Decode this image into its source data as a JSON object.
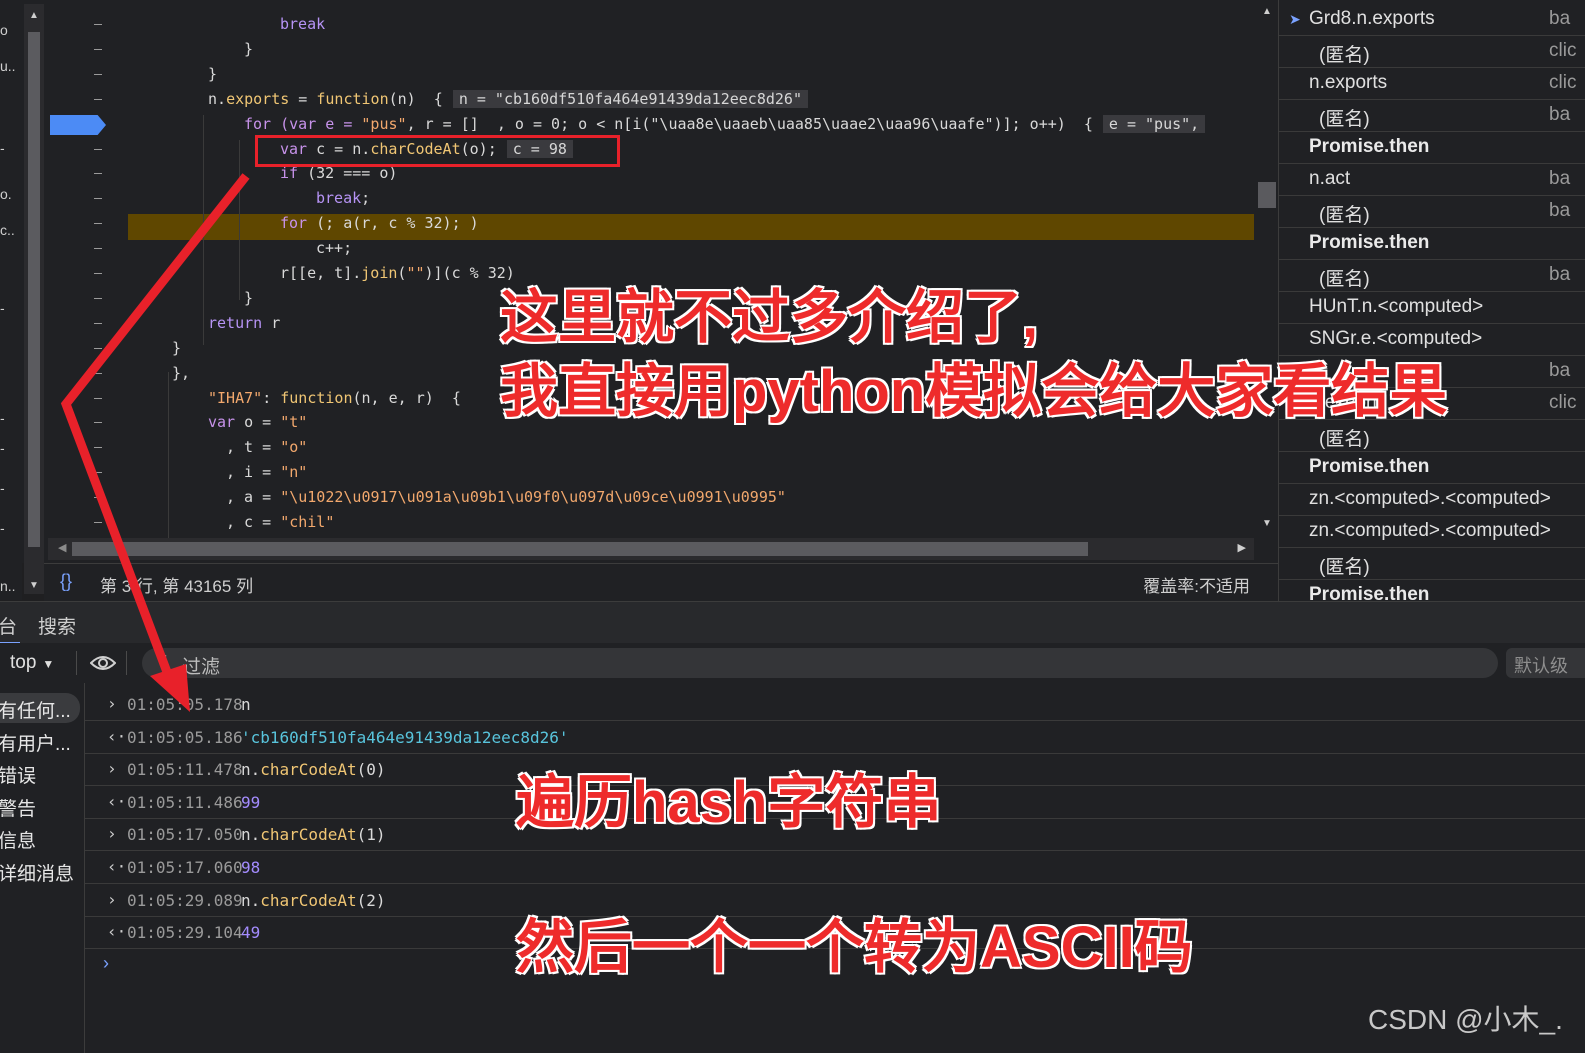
{
  "editor": {
    "lines": [
      {
        "segments": [
          {
            "t": "break",
            "c": "kw2"
          }
        ]
      },
      {
        "segments": [
          {
            "t": "}",
            "c": ""
          }
        ]
      },
      {
        "segments": [
          {
            "t": "}",
            "c": ""
          }
        ]
      },
      {
        "segments": [
          {
            "t": "n.",
            "c": ""
          },
          {
            "t": "exports",
            "c": "prop"
          },
          {
            "t": " = ",
            "c": ""
          },
          {
            "t": "function",
            "c": "prop"
          },
          {
            "t": "(n)  {",
            "c": ""
          }
        ],
        "inline": "n = \"cb160df510fa464e91439da12eec8d26\""
      },
      {
        "segments": [
          {
            "t": "for",
            "c": "kw"
          },
          {
            "t": " (var e = ",
            "c": "kw"
          },
          {
            "t": "\"pus\"",
            "c": "str"
          },
          {
            "t": ", r = []  , o = 0; o < n[i(\"\\uaa8e\\uaaeb\\uaa85\\uaae2\\uaa96\\uaafe\")]; o++)  {",
            "c": ""
          }
        ],
        "inline": "e = \"pus\","
      },
      {
        "segments": [
          {
            "t": "var",
            "c": "kw"
          },
          {
            "t": " c = n.",
            "c": ""
          },
          {
            "t": "charCodeAt",
            "c": "prop"
          },
          {
            "t": "(o);",
            "c": ""
          }
        ],
        "inline": "c = 98"
      },
      {
        "segments": [
          {
            "t": "if",
            "c": "kw"
          },
          {
            "t": " (32 === o)",
            "c": ""
          }
        ]
      },
      {
        "segments": [
          {
            "t": "break",
            "c": "kw2"
          },
          {
            "t": ";",
            "c": ""
          }
        ]
      },
      {
        "segments": [
          {
            "t": "for",
            "c": "kw"
          },
          {
            "t": " (; a(r, c % 32); )",
            "c": ""
          }
        ]
      },
      {
        "segments": [
          {
            "t": "c++;",
            "c": ""
          }
        ]
      },
      {
        "segments": [
          {
            "t": "r[[e, t].",
            "c": ""
          },
          {
            "t": "join",
            "c": "prop"
          },
          {
            "t": "(",
            "c": ""
          },
          {
            "t": "\"\"",
            "c": "str"
          },
          {
            "t": ")](c % 32)",
            "c": ""
          }
        ]
      },
      {
        "segments": [
          {
            "t": "}",
            "c": ""
          }
        ]
      },
      {
        "segments": [
          {
            "t": "return",
            "c": "kw2"
          },
          {
            "t": " r",
            "c": ""
          }
        ]
      },
      {
        "segments": [
          {
            "t": "}",
            "c": ""
          }
        ]
      },
      {
        "segments": [
          {
            "t": "},",
            "c": ""
          }
        ]
      },
      {
        "segments": [
          {
            "t": "\"IHA7\"",
            "c": "str"
          },
          {
            "t": ": ",
            "c": ""
          },
          {
            "t": "function",
            "c": "prop"
          },
          {
            "t": "(n, e, r)  {",
            "c": ""
          }
        ]
      },
      {
        "segments": [
          {
            "t": "var",
            "c": "kw"
          },
          {
            "t": " o = ",
            "c": ""
          },
          {
            "t": "\"t\"",
            "c": "str"
          }
        ]
      },
      {
        "segments": [
          {
            "t": ", t = ",
            "c": ""
          },
          {
            "t": "\"o\"",
            "c": "str"
          }
        ]
      },
      {
        "segments": [
          {
            "t": ", i = ",
            "c": ""
          },
          {
            "t": "\"n\"",
            "c": "str"
          }
        ]
      },
      {
        "segments": [
          {
            "t": ", a = ",
            "c": ""
          },
          {
            "t": "\"\\u1022\\u0917\\u091a\\u09b1\\u09f0\\u097d\\u09ce\\u0991\\u0995\"",
            "c": "str"
          }
        ]
      },
      {
        "segments": [
          {
            "t": ", c = ",
            "c": ""
          },
          {
            "t": "\"chil\"",
            "c": "str"
          }
        ]
      }
    ],
    "left_rail_chars": [
      "o",
      "u..",
      "-",
      "o.",
      "c..",
      "-",
      "-",
      "-",
      "-",
      "-",
      "n.."
    ]
  },
  "status_bar": {
    "braces": "{}",
    "position": "第 3 行, 第 43165 列",
    "coverage": "覆盖率:不适用"
  },
  "call_stack": [
    {
      "fn": "Grd8.n.exports",
      "src": "ba",
      "current": true,
      "bold": false,
      "sub": false
    },
    {
      "fn": "(匿名)",
      "src": "clic",
      "current": false,
      "bold": false,
      "sub": true
    },
    {
      "fn": "n.exports",
      "src": "clic",
      "current": false,
      "bold": false,
      "sub": false
    },
    {
      "fn": "(匿名)",
      "src": "ba",
      "current": false,
      "bold": false,
      "sub": true
    },
    {
      "fn": "Promise.then",
      "src": "",
      "current": false,
      "bold": true,
      "sub": false
    },
    {
      "fn": "n.act",
      "src": "ba",
      "current": false,
      "bold": false,
      "sub": false
    },
    {
      "fn": "(匿名)",
      "src": "ba",
      "current": false,
      "bold": false,
      "sub": true
    },
    {
      "fn": "Promise.then",
      "src": "",
      "current": false,
      "bold": true,
      "sub": false
    },
    {
      "fn": "(匿名)",
      "src": "ba",
      "current": false,
      "bold": false,
      "sub": true
    },
    {
      "fn": "HUnT.n.<computed>",
      "src": "",
      "current": false,
      "bold": false,
      "sub": false
    },
    {
      "fn": "SNGr.e.<computed>",
      "src": "",
      "current": false,
      "bold": false,
      "sub": false
    },
    {
      "fn": "",
      "src": "ba",
      "current": false,
      "bold": false,
      "sub": false
    },
    {
      "fn": "n.exports",
      "src": "clic",
      "current": false,
      "bold": false,
      "sub": false
    },
    {
      "fn": "(匿名)",
      "src": "",
      "current": false,
      "bold": false,
      "sub": true
    },
    {
      "fn": "Promise.then",
      "src": "",
      "current": false,
      "bold": true,
      "sub": false
    },
    {
      "fn": "zn.<computed>.<computed>",
      "src": "",
      "current": false,
      "bold": false,
      "sub": false
    },
    {
      "fn": "zn.<computed>.<computed>",
      "src": "",
      "current": false,
      "bold": false,
      "sub": false
    },
    {
      "fn": "(匿名)",
      "src": "",
      "current": false,
      "bold": false,
      "sub": true
    },
    {
      "fn": "Promise.then",
      "src": "",
      "current": false,
      "bold": true,
      "sub": false
    }
  ],
  "drawer": {
    "console_tab": "台",
    "search_tab": "搜索"
  },
  "console_toolbar": {
    "context": "top",
    "filter_placeholder": "过滤",
    "levels": "默认级"
  },
  "console_sidebar": [
    "有任何...",
    "有用户...",
    "错误",
    "警告",
    "信息",
    "详细消息"
  ],
  "console_messages": [
    {
      "dir": ">",
      "ts": "01:05:05.178",
      "kind": "input",
      "text": "n",
      "method": "",
      "arg": ""
    },
    {
      "dir": "<·",
      "ts": "01:05:05.186",
      "kind": "string",
      "text": "'cb160df510fa464e91439da12eec8d26'",
      "method": "",
      "arg": ""
    },
    {
      "dir": ">",
      "ts": "01:05:11.478",
      "kind": "call",
      "text": "n.",
      "method": "charCodeAt",
      "arg": "(0)"
    },
    {
      "dir": "<·",
      "ts": "01:05:11.486",
      "kind": "number",
      "text": "99",
      "method": "",
      "arg": ""
    },
    {
      "dir": ">",
      "ts": "01:05:17.050",
      "kind": "call",
      "text": "n.",
      "method": "charCodeAt",
      "arg": "(1)"
    },
    {
      "dir": "<·",
      "ts": "01:05:17.060",
      "kind": "number",
      "text": "98",
      "method": "",
      "arg": ""
    },
    {
      "dir": ">",
      "ts": "01:05:29.089",
      "kind": "call",
      "text": "n.",
      "method": "charCodeAt",
      "arg": "(2)"
    },
    {
      "dir": "<·",
      "ts": "01:05:29.104",
      "kind": "number",
      "text": "49",
      "method": "",
      "arg": ""
    }
  ],
  "annotations": {
    "line1": "这里就不过多介绍了,",
    "line2": "我直接用python模拟会给大家看结果",
    "line3": "遍历hash字符串",
    "line4": "然后一个一个转为ASCII码"
  },
  "watermark": "CSDN @小木_.",
  "colors": {
    "annotation_red": "#e8212a",
    "breakpoint_blue": "#4c8bf5",
    "exec_line": "#5f4700"
  }
}
